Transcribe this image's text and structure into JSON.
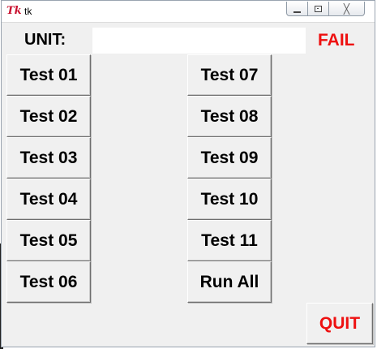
{
  "window": {
    "title": "tk",
    "icon": "tk-feather-icon",
    "controls": [
      "minimize",
      "maximize",
      "close"
    ],
    "close_glyph": "╳"
  },
  "unit": {
    "label": "UNIT:",
    "value": "",
    "placeholder": ""
  },
  "status": {
    "text": "FAIL",
    "color": "#ee1111"
  },
  "tests_left": [
    {
      "label": "Test 01"
    },
    {
      "label": "Test 02"
    },
    {
      "label": "Test 03"
    },
    {
      "label": "Test 04"
    },
    {
      "label": "Test 05"
    },
    {
      "label": "Test 06"
    }
  ],
  "tests_right": [
    {
      "label": "Test 07"
    },
    {
      "label": "Test 08"
    },
    {
      "label": "Test 09"
    },
    {
      "label": "Test 10"
    },
    {
      "label": "Test 11"
    },
    {
      "label": "Run All"
    }
  ],
  "quit": {
    "label": "QUIT",
    "color": "#ee1111"
  },
  "colors": {
    "background": "#f0f0f0",
    "accent_red": "#ee1111"
  }
}
